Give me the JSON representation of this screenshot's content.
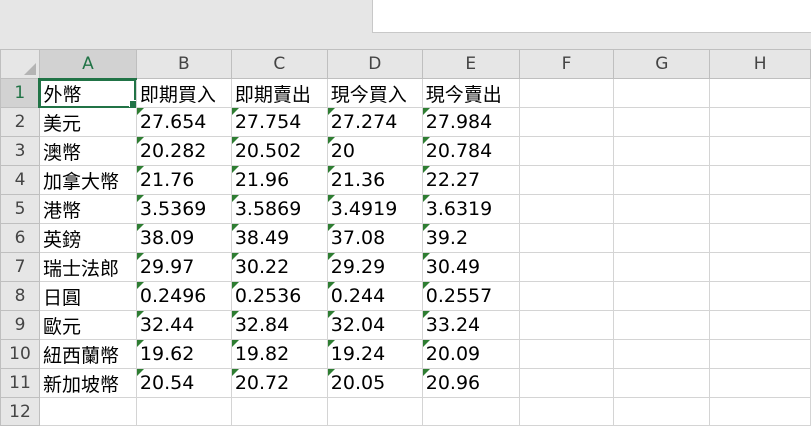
{
  "spreadsheet": {
    "columns": [
      "A",
      "B",
      "C",
      "D",
      "E",
      "F",
      "G",
      "H"
    ],
    "rows": [
      "1",
      "2",
      "3",
      "4",
      "5",
      "6",
      "7",
      "8",
      "9",
      "10",
      "11",
      "12"
    ],
    "selected_cell": "A1",
    "cells": [
      [
        "外幣",
        "即期買入",
        "即期賣出",
        "現今買入",
        "現今賣出"
      ],
      [
        "美元",
        "27.654",
        "27.754",
        "27.274",
        "27.984"
      ],
      [
        "澳幣",
        "20.282",
        "20.502",
        "20",
        "20.784"
      ],
      [
        "加拿大幣",
        "21.76",
        "21.96",
        "21.36",
        "22.27"
      ],
      [
        "港幣",
        "3.5369",
        "3.5869",
        "3.4919",
        "3.6319"
      ],
      [
        "英鎊",
        "38.09",
        "38.49",
        "37.08",
        "39.2"
      ],
      [
        "瑞士法郎",
        "29.97",
        "30.22",
        "29.29",
        "30.49"
      ],
      [
        "日圓",
        "0.2496",
        "0.2536",
        "0.244",
        "0.2557"
      ],
      [
        "歐元",
        "32.44",
        "32.84",
        "32.04",
        "33.24"
      ],
      [
        "紐西蘭幣",
        "19.62",
        "19.82",
        "19.24",
        "20.09"
      ],
      [
        "新加坡幣",
        "20.54",
        "20.72",
        "20.05",
        "20.96"
      ]
    ],
    "number_stored_as_text_flag_color": "#2e7d32",
    "accent_color": "#217346"
  }
}
